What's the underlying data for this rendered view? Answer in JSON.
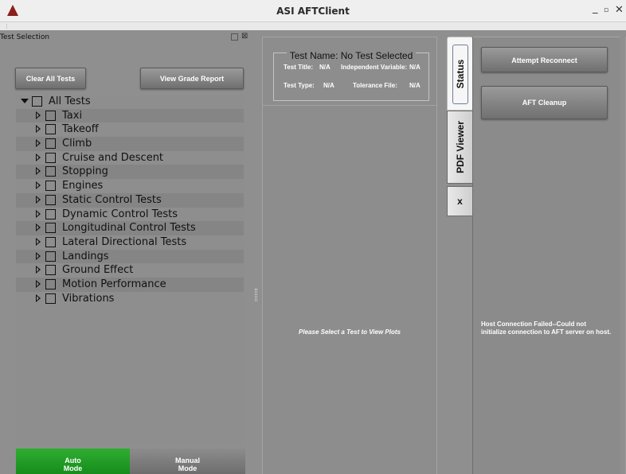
{
  "window": {
    "title": "ASI AFTClient",
    "controls": {
      "minimize": "_",
      "maximize": "▫",
      "close": "✕"
    },
    "logo_icon": "red-triangle-logo"
  },
  "left_panel": {
    "title": "Test Selection",
    "clear_button": "Clear All Tests",
    "grade_button": "View Grade Report",
    "tree": {
      "root": "All Tests",
      "items": [
        "Taxi",
        "Takeoff",
        "Climb",
        "Cruise and Descent",
        "Stopping",
        "Engines",
        "Static Control Tests",
        "Dynamic Control Tests",
        "Longitudinal Control Tests",
        "Lateral Directional Tests",
        "Landings",
        "Ground Effect",
        "Motion Performance",
        "Vibrations"
      ]
    },
    "modes": {
      "auto": [
        "Auto",
        "Mode"
      ],
      "manual": [
        "Manual",
        "Mode"
      ],
      "active": "auto"
    }
  },
  "center_panel": {
    "test_name": "Test Name: No Test Selected",
    "test_title_label": "Test Title:",
    "test_title_value": "N/A",
    "independent_label": "Independent Variable:",
    "independent_value": "N/A",
    "test_type_label": "Test Type:",
    "test_type_value": "N/A",
    "tolerance_label": "Tolerance File:",
    "tolerance_value": "N/A",
    "plot_message": "Please Select a Test to View Plots"
  },
  "tabs": {
    "status": "Status",
    "pdf_viewer": "PDF Viewer",
    "close": "x",
    "active": "status"
  },
  "right_panel": {
    "reconnect_button": "Attempt Reconnect",
    "cleanup_button": "AFT Cleanup",
    "status_message": "Host Connection Failed--Could not initialize connection to AFT server on host."
  },
  "colors": {
    "logo": "#8a1f1b",
    "auto_mode_active": "#22a026",
    "panel_background": "#8f8f8f"
  }
}
